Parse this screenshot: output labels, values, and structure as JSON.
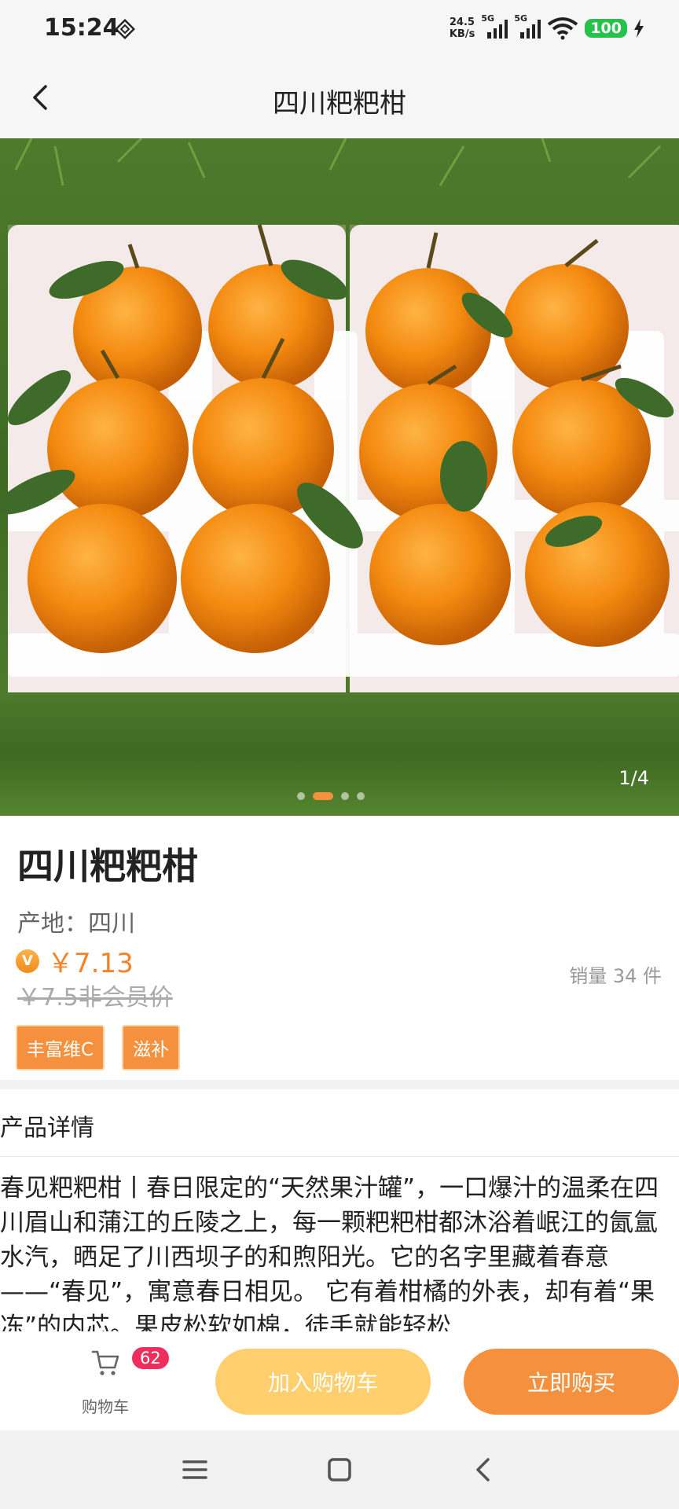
{
  "status_bar": {
    "time": "15:24",
    "net_speed_value": "24.5",
    "net_speed_unit": "KB/s",
    "sim1_type": "5G",
    "sim2_type": "5G",
    "battery": "100"
  },
  "header": {
    "title": "四川粑粑柑"
  },
  "gallery": {
    "counter": "1/4",
    "total_images": 4,
    "active_index": 2
  },
  "product": {
    "name": "四川粑粑柑",
    "origin": "产地：四川",
    "vip_badge": "V",
    "member_price": "￥7.13",
    "original_price": "￥7.5非会员价",
    "sales": "销量 34 件",
    "tags": [
      "丰富维C",
      "滋补"
    ]
  },
  "detail": {
    "header": "产品详情",
    "body": "春见粑粑柑丨春日限定的“天然果汁罐”，一口爆汁的温柔在四川眉山和蒲江的丘陵之上，每一颗粑粑柑都沐浴着岷江的氤氲水汽，晒足了川西坝子的和煦阳光。它的名字里藏着春意——“春见”，寓意春日相见。 它有着柑橘的外表，却有着“果冻”的内芯。果皮松软如棉，徒手就能轻松"
  },
  "bottom_bar": {
    "cart_label": "购物车",
    "cart_count": "62",
    "add_to_cart": "加入购物车",
    "buy_now": "立即购买"
  },
  "colors": {
    "accent": "#f5913e",
    "add_button": "#ffcf6d",
    "badge": "#ee2f5e",
    "battery": "#27c24c"
  }
}
